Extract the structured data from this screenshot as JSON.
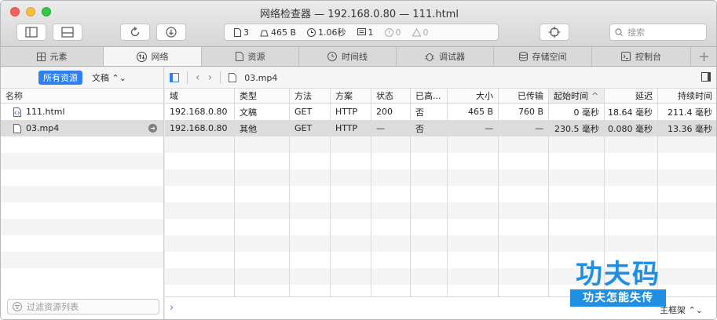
{
  "window": {
    "title": "网络检查器 — 192.168.0.80 — 111.html"
  },
  "toolbar": {
    "stats": {
      "requests": "3",
      "size": "465 B",
      "time": "1.06秒",
      "messages": "1",
      "errors": "0",
      "warnings": "0"
    },
    "search_placeholder": "搜索"
  },
  "tabs": [
    {
      "label": "元素",
      "icon": "elements-icon"
    },
    {
      "label": "网络",
      "icon": "network-icon"
    },
    {
      "label": "资源",
      "icon": "resources-icon"
    },
    {
      "label": "时间线",
      "icon": "timeline-icon"
    },
    {
      "label": "调试器",
      "icon": "debugger-icon"
    },
    {
      "label": "存储空间",
      "icon": "storage-icon"
    },
    {
      "label": "控制台",
      "icon": "console-icon"
    }
  ],
  "sidebar": {
    "filter_all": "所有资源",
    "filter_type": "文稿",
    "column_name": "名称",
    "files": [
      "111.html",
      "03.mp4"
    ],
    "filter_placeholder": "过滤资源列表"
  },
  "main": {
    "breadcrumb": "03.mp4",
    "columns": [
      "域",
      "类型",
      "方法",
      "方案",
      "状态",
      "已高...",
      "大小",
      "已传输",
      "起始时间",
      "延迟",
      "持续时间"
    ],
    "rows": [
      [
        "192.168.0.80",
        "文稿",
        "GET",
        "HTTP",
        "200",
        "否",
        "465 B",
        "760 B",
        "0 毫秒",
        "18.64 毫秒",
        "211.4 毫秒"
      ],
      [
        "192.168.0.80",
        "其他",
        "GET",
        "HTTP",
        "—",
        "否",
        "—",
        "—",
        "230.5 毫秒",
        "0.080 毫秒",
        "13.36 毫秒"
      ]
    ],
    "frame_selector": "主框架"
  },
  "watermark": {
    "top": "功夫码",
    "bottom": "功夫怎能失传"
  }
}
